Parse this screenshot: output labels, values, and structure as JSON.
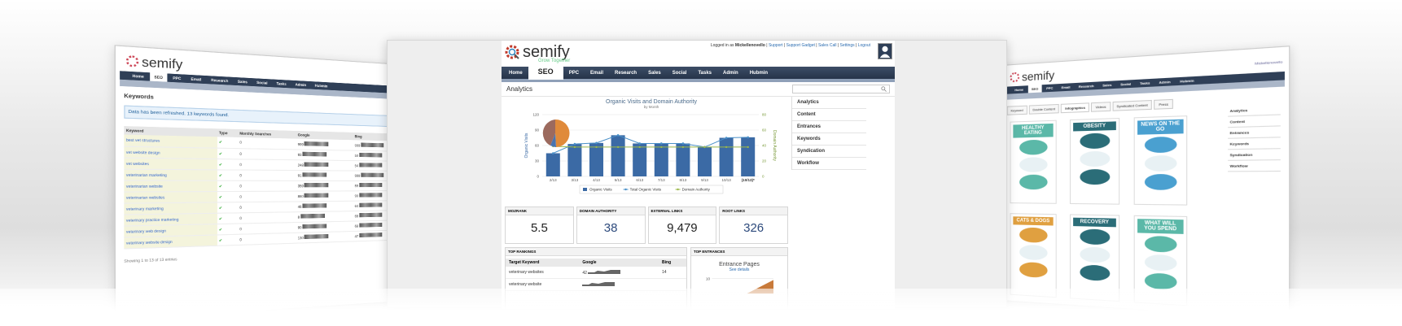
{
  "brand": {
    "name": "semify",
    "tagline": "Grow Together"
  },
  "colors": {
    "nav_bg": "#2f3f57",
    "bar": "#3b6aa5",
    "line_total": "#4a90c8",
    "line_da": "#9bb84a",
    "pie_a": "#9c6a5e",
    "pie_b": "#e08a3a",
    "pie_c": "#4a74b0"
  },
  "header": {
    "login_prefix": "Logged in as",
    "login_user": "Mickellenovello",
    "links": [
      "Support",
      "Support Gadget",
      "Sales Call",
      "Settings",
      "Logout"
    ]
  },
  "nav": {
    "items": [
      "Home",
      "SEO",
      "PPC",
      "Email",
      "Research",
      "Sales",
      "Social",
      "Tasks",
      "Admin",
      "Hubmin"
    ],
    "active": "SEO"
  },
  "page": {
    "title": "Analytics"
  },
  "right_menu": [
    "Analytics",
    "Content",
    "Entrances",
    "Keywords",
    "Syndication",
    "Workflow"
  ],
  "chart_data": {
    "type": "bar",
    "title": "Organic Visits and Domain Authority",
    "subtitle": "by Month",
    "ylabel": "Organic Visits",
    "y2label": "Domain Authority",
    "ylim": [
      0,
      120
    ],
    "y2lim": [
      0,
      80
    ],
    "yticks": [
      0,
      30,
      60,
      90,
      120
    ],
    "y2ticks": [
      0,
      20,
      40,
      60,
      80
    ],
    "categories": [
      "2/13",
      "3/13",
      "4/13",
      "5/13",
      "6/13",
      "7/13",
      "8/13",
      "9/13",
      "10/13"
    ],
    "series": [
      {
        "name": "Organic Visits",
        "type": "bar",
        "values": [
          45,
          63,
          65,
          80,
          64,
          64,
          64,
          57,
          75,
          76
        ]
      },
      {
        "name": "Total Organic Visits",
        "type": "line",
        "values": [
          45,
          63,
          65,
          80,
          64,
          64,
          64,
          57,
          75,
          76
        ]
      },
      {
        "name": "Domain Authority",
        "type": "line",
        "values": [
          39,
          38,
          38,
          38,
          38,
          38,
          38,
          38,
          38,
          38
        ]
      }
    ],
    "x_extra_label": "(10/13)*"
  },
  "metrics": [
    {
      "label": "MOZRANK",
      "value": "5.5",
      "link": false
    },
    {
      "label": "DOMAIN AUTHORITY",
      "value": "38",
      "link": true
    },
    {
      "label": "EXTERNAL LINKS",
      "value": "9,479",
      "link": false
    },
    {
      "label": "ROOT LINKS",
      "value": "326",
      "link": true
    }
  ],
  "top_rankings": {
    "title": "TOP RANKINGS",
    "columns": [
      "Target Keyword",
      "Google",
      "Bing"
    ],
    "rows": [
      {
        "keyword": "veterinary websites",
        "google": "42",
        "bing": "14"
      },
      {
        "keyword": "veterinary website",
        "google": "",
        "bing": ""
      }
    ]
  },
  "top_entrances": {
    "title": "TOP ENTRANCES",
    "chart_title": "Entrance Pages",
    "link": "See details",
    "tick": "10"
  },
  "left_screen": {
    "heading": "Keywords",
    "alert": "Data has been refreshed. 13 keywords found.",
    "columns": [
      "Keyword",
      "Type",
      "Monthly Searches",
      "Google",
      "Bing"
    ],
    "rows": [
      [
        "best vet structures",
        "0",
        "999",
        "999"
      ],
      [
        "vet website design",
        "0",
        "93",
        "50"
      ],
      [
        "vet websites",
        "0",
        "248",
        "54"
      ],
      [
        "veterinarian marketing",
        "0",
        "91",
        "999"
      ],
      [
        "veterinarian website",
        "0",
        "359",
        "59"
      ],
      [
        "veterinarian websites",
        "0",
        "880",
        "90"
      ],
      [
        "veterinary marketing",
        "0",
        "46",
        "64"
      ],
      [
        "veterinary practice marketing",
        "0",
        "8",
        "68"
      ],
      [
        "veterinary web design",
        "0",
        "90",
        "68"
      ],
      [
        "veterinary website design",
        "0",
        "130",
        "47"
      ]
    ],
    "footer": "Showing 1 to 13 of 13 entries"
  },
  "right_screen": {
    "tabs": [
      "Keyword",
      "Double Content",
      "Infographics",
      "Videos",
      "Syndicated Content",
      "Press"
    ],
    "active_tab": "Infographics",
    "menu": [
      "Analytics",
      "Content",
      "Entrances",
      "Keywords",
      "Syndication",
      "Workflow"
    ],
    "infographics": [
      {
        "title": "HEALTHY EATING",
        "color": "#5bb8a8"
      },
      {
        "title": "OBESITY",
        "color": "#2b6d78"
      },
      {
        "title": "NEWS ON THE GO",
        "color": "#4aa0d0"
      },
      {
        "title": "CATS & DOGS",
        "color": "#e0a040"
      },
      {
        "title": "RECOVERY",
        "color": "#2b6d78"
      },
      {
        "title": "WHAT WILL YOU SPEND",
        "color": "#5bb8a8"
      }
    ]
  }
}
